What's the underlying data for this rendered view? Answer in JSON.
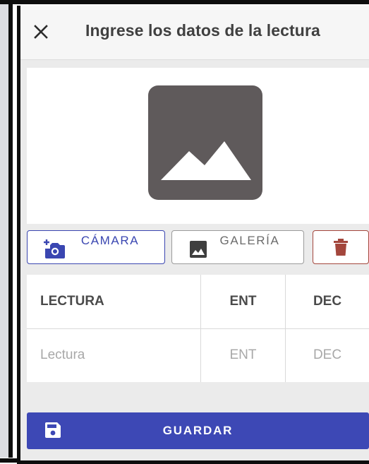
{
  "dialog": {
    "title": "Ingrese los datos de la lectura"
  },
  "media_buttons": {
    "camera_label": "CÁMARA",
    "gallery_label": "GALERÍA"
  },
  "reading_table": {
    "headers": [
      "LECTURA",
      "ENT",
      "DEC"
    ],
    "placeholders": [
      "Lectura",
      "ENT",
      "DEC"
    ]
  },
  "actions": {
    "save_label": "GUARDAR"
  },
  "colors": {
    "primary": "#3d48b5",
    "delete": "#a3463c",
    "placeholder_image": "#5f5a5b"
  },
  "icons": {
    "close": "close-icon",
    "camera": "add-camera-icon",
    "gallery": "image-icon",
    "delete": "trash-icon",
    "save": "floppy-disk-icon",
    "placeholder": "image-placeholder-icon"
  }
}
